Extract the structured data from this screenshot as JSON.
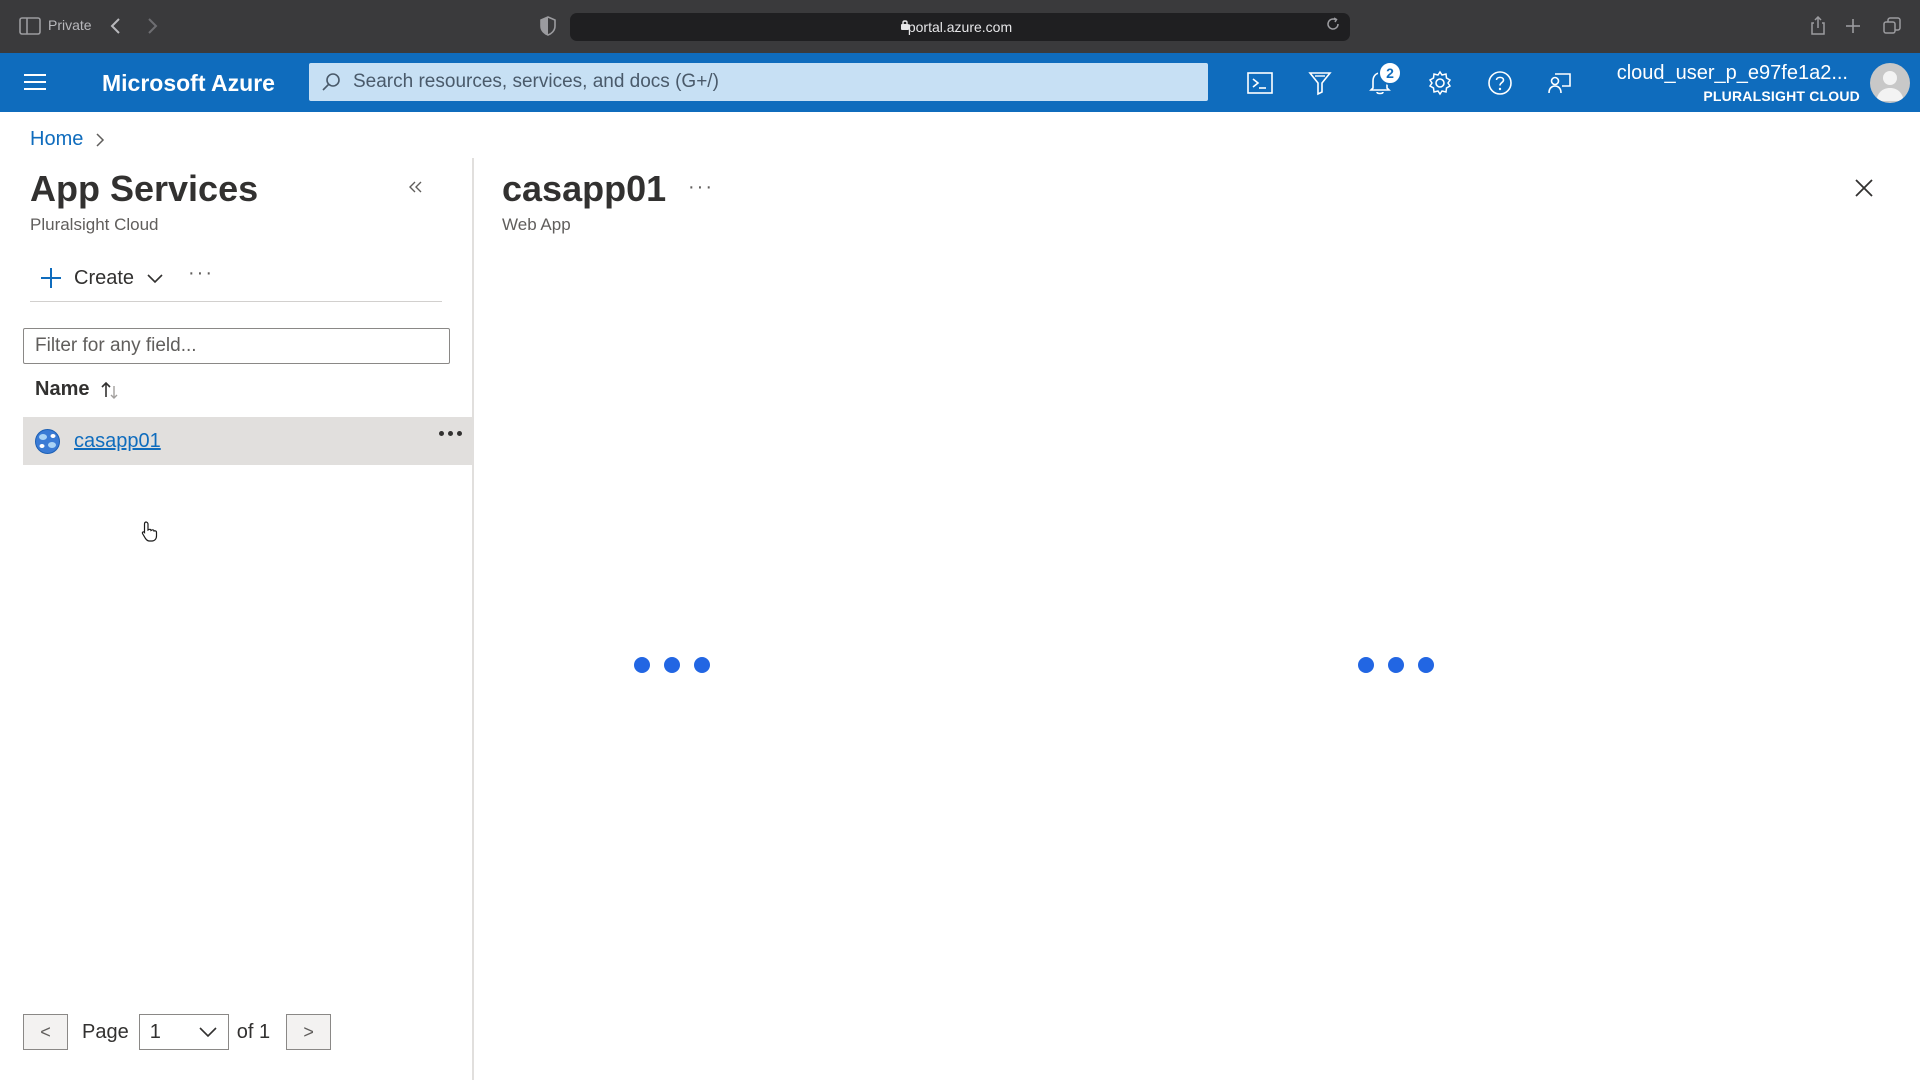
{
  "browser": {
    "private_label": "Private",
    "url": "portal.azure.com"
  },
  "header": {
    "brand": "Microsoft Azure",
    "search_placeholder": "Search resources, services, and docs (G+/)",
    "notification_count": "2",
    "user_name": "cloud_user_p_e97fe1a2...",
    "user_org": "PLURALSIGHT CLOUD",
    "icons": [
      "cloud-shell-icon",
      "directory-filter-icon",
      "notifications-icon",
      "settings-icon",
      "help-icon",
      "feedback-icon"
    ]
  },
  "breadcrumb": {
    "home": "Home"
  },
  "left_pane": {
    "title": "App Services",
    "subtitle": "Pluralsight Cloud",
    "create_label": "Create",
    "more_label": "···",
    "filter_placeholder": "Filter for any field...",
    "column_name": "Name",
    "rows": [
      {
        "name": "casapp01"
      }
    ],
    "pager": {
      "prev": "<",
      "next": ">",
      "page_label": "Page",
      "current_page": "1",
      "of_label": "of 1"
    }
  },
  "detail": {
    "title": "casapp01",
    "more_label": "···",
    "subtitle": "Web App",
    "state": "loading"
  },
  "colors": {
    "header_blue": "#0f6cbd",
    "search_bg": "#c7e0f4",
    "loader_dot": "#2266e3",
    "selected_row": "#e1dfdd"
  }
}
